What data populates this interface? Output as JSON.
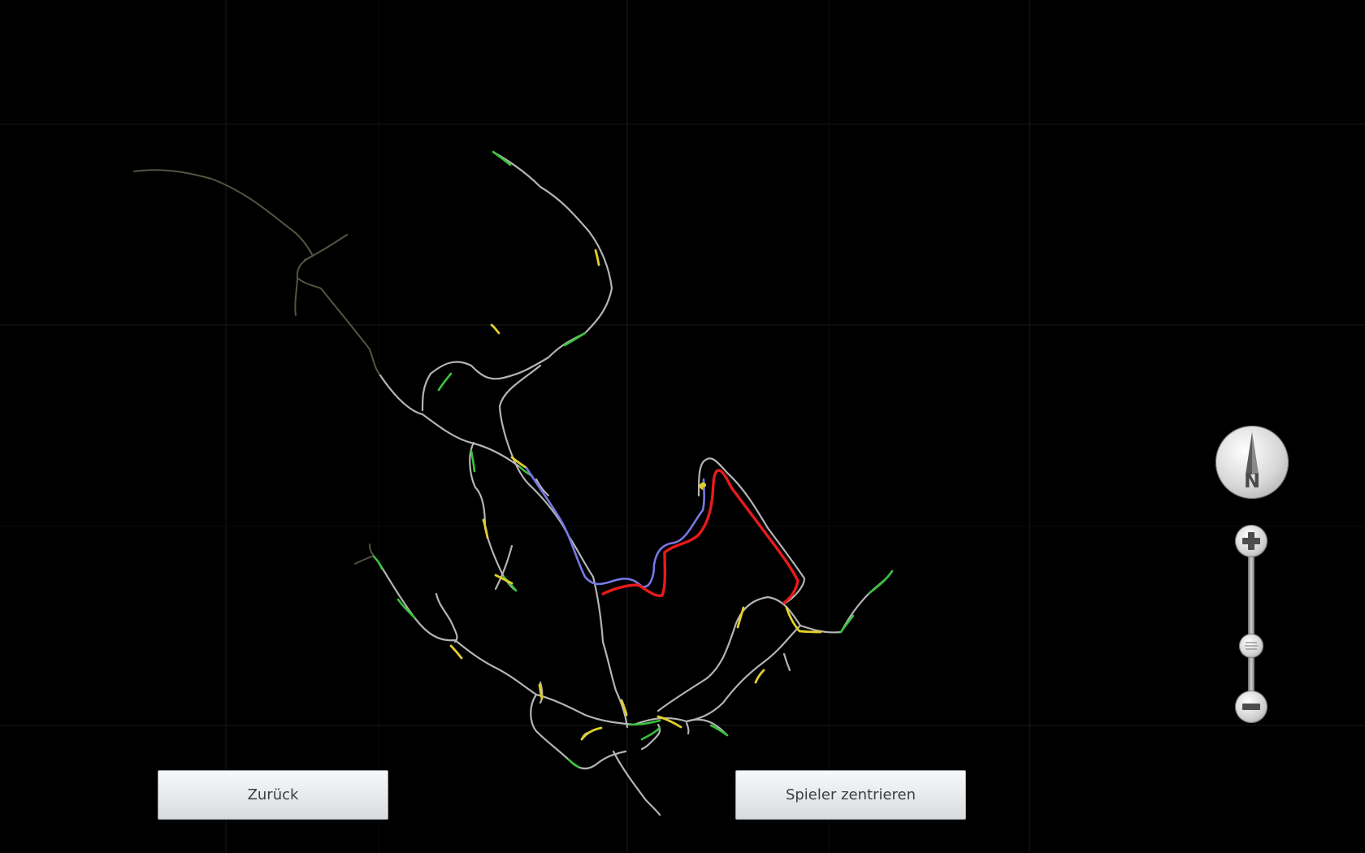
{
  "buttons": {
    "back_label": "Zurück",
    "center_player_label": "Spieler zentrieren"
  },
  "compass": {
    "north_label": "N",
    "icon": "compass-north-icon"
  },
  "zoom": {
    "zoom_in_icon": "plus-icon",
    "zoom_out_icon": "minus-icon",
    "level": 0.3
  },
  "colors": {
    "background": "#000000",
    "road": "#b4b4b4",
    "road_dark": "#545441",
    "route_planned": "#e81a1a",
    "route_driven": "#7878e6",
    "traffic_free": "#39c43c",
    "traffic_slow": "#e2d02a"
  }
}
